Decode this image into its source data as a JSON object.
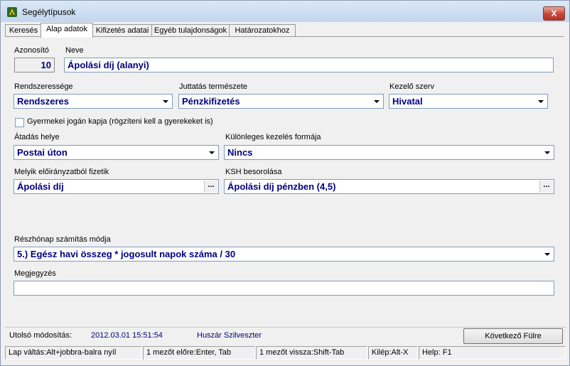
{
  "window": {
    "title": "Segélytípusok",
    "close_label": "X"
  },
  "tabs": [
    {
      "label": "Keresés"
    },
    {
      "label": "Alap adatok"
    },
    {
      "label": "Kifizetés adatai"
    },
    {
      "label": "Egyéb tulajdonságok"
    },
    {
      "label": "Határozatokhoz"
    }
  ],
  "form": {
    "azonosito": {
      "label": "Azonosító",
      "value": "10"
    },
    "neve": {
      "label": "Neve",
      "value": "Ápolási díj (alanyi)"
    },
    "rendszeresseg": {
      "label": "Rendszeressége",
      "value": "Rendszeres"
    },
    "juttatas": {
      "label": "Juttatás természete",
      "value": "Pénzkifizetés"
    },
    "kezelo": {
      "label": "Kezelő szerv",
      "value": "Hivatal"
    },
    "gyermekei": {
      "label": "Gyermekei jogán kapja (rögzíteni kell a gyerekeket is)",
      "checked": false
    },
    "atadas": {
      "label": "Átadás helye",
      "value": "Postai úton"
    },
    "kulonleges": {
      "label": "Különleges kezelés formája",
      "value": "Nincs"
    },
    "eloiranyzat": {
      "label": "Melyik előirányzatból fizetik",
      "value": "Ápolási díj"
    },
    "ksh": {
      "label": "KSH besorolása",
      "value": "Ápolási díj pénzben (4,5)"
    },
    "reszhonap": {
      "label": "Részhónap számítás módja",
      "value": "5.) Egész havi összeg * jogosult napok száma / 30"
    },
    "megjegyzes": {
      "label": "Megjegyzés",
      "value": ""
    },
    "ellipsis": "..."
  },
  "footer": {
    "last_modified_label": "Utolsó módosítás:",
    "last_modified_value": "2012.03.01 15:51:54",
    "user": "Huszár Szilveszter",
    "next_tab_button": "Következő Fülre"
  },
  "statusbar": [
    "Lap váltás:Alt+jobbra-balra nyíl",
    "1 mezőt előre:Enter, Tab",
    "1 mezőt vissza:Shift-Tab",
    "Kilép:Alt-X",
    "Help: F1"
  ]
}
